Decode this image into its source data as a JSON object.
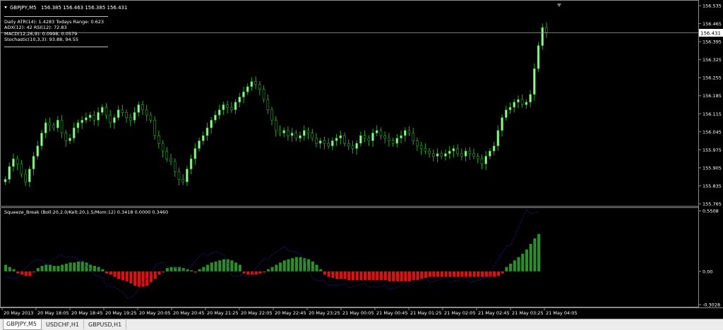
{
  "header": {
    "symbol": "GBPJPY,M5",
    "ohlc": "156.385 156.463 156.385 156.431"
  },
  "info_panel": {
    "lines": [
      "Daily ATR(14): 1.4283 Todays Range: 0.623",
      "ADX(12): 42 RSI(12): 72.83",
      "MACD(12,26,9): 0.0998, 0.0579",
      "Stochastic(10,3,3): 93.88, 94.55"
    ]
  },
  "price_axis": {
    "ticks": [
      "156.535",
      "156.465",
      "156.395",
      "156.325",
      "156.255",
      "156.185",
      "156.115",
      "156.045",
      "155.975",
      "155.905",
      "155.835",
      "155.765"
    ],
    "current_price": "156.431"
  },
  "indicator": {
    "title": "Squeeze_Break (Boll:20,2.0/Kelt:20,1.5/Mom:12) 0.3418 0.0000 0.3460",
    "ticks": [
      "0.5508",
      "0.00",
      "-0.3028"
    ]
  },
  "time_axis": {
    "labels": [
      "20 May 2013",
      "20 May 18:05",
      "20 May 18:45",
      "20 May 19:25",
      "20 May 20:05",
      "20 May 20:45",
      "20 May 21:25",
      "20 May 22:05",
      "20 May 22:45",
      "20 May 23:25",
      "21 May 00:05",
      "21 May 00:45",
      "21 May 01:25",
      "21 May 02:05",
      "21 May 02:45",
      "21 May 03:25",
      "21 May 04:05"
    ]
  },
  "tabs": [
    {
      "label": "GBPJPY,M5",
      "active": true
    },
    {
      "label": "USDCHF,H1",
      "active": false
    },
    {
      "label": "GBPUSD,H1",
      "active": false
    }
  ],
  "colors": {
    "background": "#000000",
    "bull_candle": "#98f098",
    "bear_candle": "#000000",
    "wick": "#28a828",
    "histogram_positive": "#2e8b2e",
    "histogram_negative": "#e01010",
    "momentum_line": "#1a1a8c"
  },
  "chart_data": {
    "type": "candlestick",
    "price_range": [
      155.765,
      156.535
    ],
    "series": [
      {
        "name": "price",
        "close": [
          155.86,
          155.91,
          155.94,
          155.92,
          155.88,
          155.85,
          155.9,
          155.95,
          155.99,
          156.04,
          156.08,
          156.07,
          156.06,
          156.09,
          156.04,
          156.01,
          156.02,
          156.06,
          156.08,
          156.09,
          156.1,
          156.11,
          156.09,
          156.12,
          156.14,
          156.11,
          156.08,
          156.1,
          156.13,
          156.12,
          156.1,
          156.09,
          156.12,
          156.15,
          156.13,
          156.11,
          156.09,
          156.03,
          156.0,
          155.97,
          155.94,
          155.93,
          155.89,
          155.86,
          155.85,
          155.9,
          155.94,
          155.98,
          156.01,
          156.03,
          156.06,
          156.09,
          156.11,
          156.13,
          156.15,
          156.14,
          156.13,
          156.16,
          156.18,
          156.2,
          156.22,
          156.24,
          156.23,
          156.21,
          156.17,
          156.13,
          156.09,
          156.05,
          156.04,
          156.05,
          156.03,
          156.04,
          156.02,
          156.03,
          156.05,
          156.04,
          156.02,
          156.0,
          156.01,
          156.0,
          155.99,
          156.01,
          156.02,
          156.03,
          156.0,
          155.99,
          155.98,
          156.0,
          156.03,
          156.02,
          156.01,
          156.04,
          156.05,
          156.03,
          156.02,
          156.01,
          156.0,
          156.02,
          156.03,
          156.05,
          156.04,
          156.01,
          155.99,
          155.98,
          155.97,
          155.96,
          155.95,
          155.96,
          155.95,
          155.96,
          155.97,
          155.98,
          155.96,
          155.95,
          155.97,
          155.96,
          155.95,
          155.94,
          155.92,
          155.95,
          155.97,
          155.99,
          156.05,
          156.1,
          156.13,
          156.14,
          156.16,
          156.17,
          156.15,
          156.16,
          156.19,
          156.29,
          156.38,
          156.45,
          156.43
        ],
        "description": "approximate candle closes read from chart (GBPJPY M5)"
      },
      {
        "name": "Squeeze_Break",
        "values": [
          0.06,
          0.04,
          0.02,
          -0.02,
          -0.03,
          -0.04,
          -0.04,
          -0.01,
          0.03,
          0.05,
          0.06,
          0.06,
          0.05,
          0.05,
          0.06,
          0.07,
          0.08,
          0.08,
          0.09,
          0.09,
          0.08,
          0.06,
          0.05,
          0.04,
          0.02,
          -0.02,
          -0.03,
          -0.05,
          -0.07,
          -0.08,
          -0.09,
          -0.11,
          -0.13,
          -0.14,
          -0.14,
          -0.13,
          -0.1,
          -0.07,
          -0.03,
          -0.01,
          0.03,
          0.04,
          0.04,
          0.04,
          0.03,
          0.02,
          0.01,
          -0.01,
          0.02,
          0.04,
          0.06,
          0.08,
          0.09,
          0.1,
          0.11,
          0.11,
          0.1,
          0.08,
          0.06,
          -0.02,
          -0.03,
          -0.03,
          -0.03,
          -0.02,
          -0.01,
          0.02,
          0.04,
          0.06,
          0.08,
          0.1,
          0.11,
          0.12,
          0.13,
          0.13,
          0.12,
          0.11,
          0.09,
          0.06,
          0.02,
          -0.03,
          -0.05,
          -0.06,
          -0.07,
          -0.07,
          -0.07,
          -0.08,
          -0.08,
          -0.08,
          -0.08,
          -0.08,
          -0.08,
          -0.08,
          -0.08,
          -0.08,
          -0.08,
          -0.09,
          -0.09,
          -0.09,
          -0.09,
          -0.09,
          -0.09,
          -0.08,
          -0.08,
          -0.07,
          -0.06,
          -0.05,
          -0.05,
          -0.05,
          -0.05,
          -0.05,
          -0.05,
          -0.05,
          -0.05,
          -0.05,
          -0.05,
          -0.05,
          -0.05,
          -0.05,
          -0.05,
          -0.05,
          -0.05,
          -0.05,
          -0.04,
          -0.02,
          0.04,
          0.07,
          0.1,
          0.13,
          0.16,
          0.2,
          0.25,
          0.3,
          0.34
        ]
      }
    ]
  }
}
